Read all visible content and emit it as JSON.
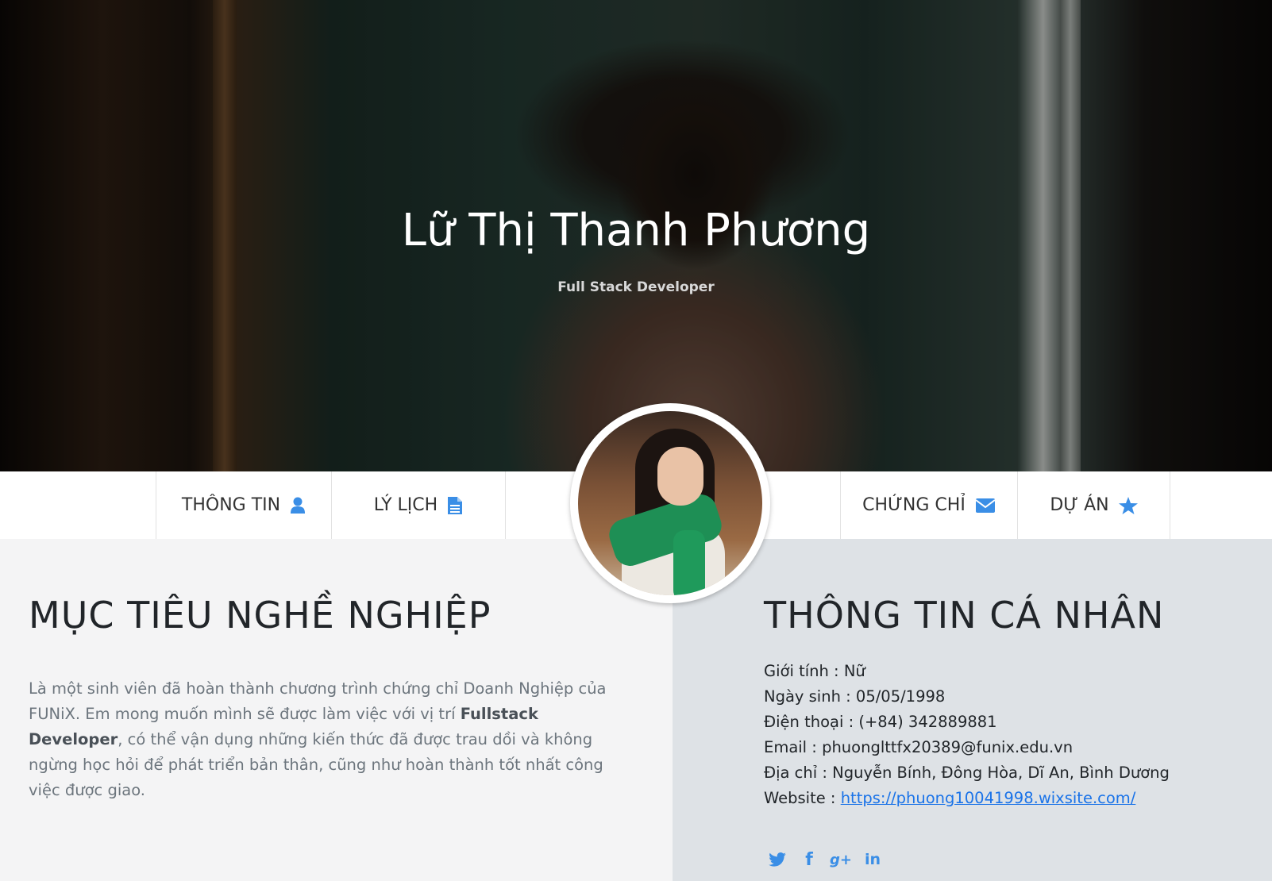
{
  "hero": {
    "name": "Lữ Thị Thanh Phương",
    "role": "Full Stack Developer"
  },
  "nav": {
    "items": [
      {
        "label": "THÔNG TIN",
        "icon": "user-icon"
      },
      {
        "label": "LÝ LỊCH",
        "icon": "file-icon"
      },
      {
        "label": "CHỨNG CHỈ",
        "icon": "envelope-icon"
      },
      {
        "label": "DỰ ÁN",
        "icon": "star-icon"
      }
    ],
    "icon_color": "#3a8ee6"
  },
  "career": {
    "title": "MỤC TIÊU NGHỀ NGHIỆP",
    "text_before": "Là một sinh viên đã hoàn thành chương trình chứng chỉ Doanh Nghiệp của FUNiX. Em mong muốn mình sẽ được làm việc với vị trí ",
    "highlight": "Fullstack Developer",
    "text_after": ", có thể vận dụng những kiến thức đã được trau dồi và không ngừng học hỏi để phát triển bản thân, cũng như hoàn thành tốt nhất công việc được giao."
  },
  "personal": {
    "title": "THÔNG TIN CÁ NHÂN",
    "gender": "Giới tính : Nữ",
    "birthday": "Ngày sinh : 05/05/1998",
    "phone": "Điện thoại : (+84) 342889881",
    "email": "Email : phuonglttfx20389@funix.edu.vn",
    "address": "Địa chỉ : Nguyễn Bính, Đông Hòa, Dĩ An, Bình Dương",
    "website_label": "Website : ",
    "website_url": "https://phuong10041998.wixsite.com/"
  },
  "social": {
    "icons": [
      "twitter-icon",
      "facebook-icon",
      "google-plus-icon",
      "linkedin-icon"
    ],
    "facebook": "f",
    "google_plus": "g+",
    "linkedin": "in"
  }
}
